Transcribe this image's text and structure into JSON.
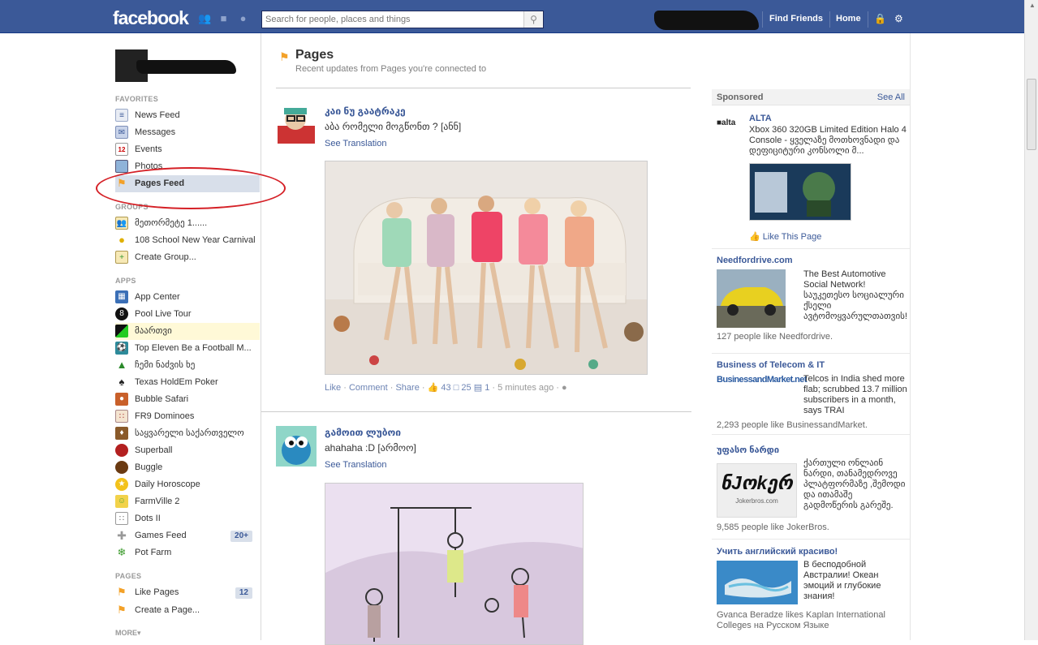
{
  "topbar": {
    "logo": "facebook",
    "search_placeholder": "Search for people, places and things",
    "find_friends": "Find Friends",
    "home": "Home"
  },
  "sidebar": {
    "favorites_header": "FAVORITES",
    "favorites": [
      {
        "label": "News Feed",
        "icon": "news-feed-icon"
      },
      {
        "label": "Messages",
        "icon": "messages-icon"
      },
      {
        "label": "Events",
        "icon": "events-icon",
        "icon_text": "12"
      },
      {
        "label": "Photos",
        "icon": "photos-icon"
      },
      {
        "label": "Pages Feed",
        "icon": "pages-feed-icon"
      }
    ],
    "groups_header": "GROUPS",
    "groups": [
      {
        "label": "მეთორმეტე 1......",
        "icon": "group-icon"
      },
      {
        "label": "108 School New Year Carnival",
        "icon": "lightbulb-icon"
      },
      {
        "label": "Create Group...",
        "icon": "create-group-icon"
      }
    ],
    "apps_header": "APPS",
    "apps": [
      {
        "label": "App Center",
        "icon": "app-center-icon"
      },
      {
        "label": "Pool Live Tour",
        "icon": "pool-icon"
      },
      {
        "label": "მაართვი",
        "icon": "app-icon"
      },
      {
        "label": "Top Eleven Be a Football M...",
        "icon": "football-icon"
      },
      {
        "label": "ჩემი ნაძვის ხე",
        "icon": "tree-icon"
      },
      {
        "label": "Texas HoldEm Poker",
        "icon": "poker-icon"
      },
      {
        "label": "Bubble Safari",
        "icon": "bubble-icon"
      },
      {
        "label": "FR9 Dominoes",
        "icon": "dominoes-icon"
      },
      {
        "label": "საყვარელი საქართველო",
        "icon": "georgia-icon"
      },
      {
        "label": "Superball",
        "icon": "superball-icon"
      },
      {
        "label": "Buggle",
        "icon": "buggle-icon"
      },
      {
        "label": "Daily Horoscope",
        "icon": "horoscope-icon"
      },
      {
        "label": "FarmVille 2",
        "icon": "farmville-icon"
      },
      {
        "label": "Dots II",
        "icon": "dots-icon"
      },
      {
        "label": "Games Feed",
        "icon": "games-feed-icon",
        "badge": "20+"
      },
      {
        "label": "Pot Farm",
        "icon": "pot-farm-icon"
      }
    ],
    "pages_header": "PAGES",
    "pages": [
      {
        "label": "Like Pages",
        "icon": "like-pages-icon",
        "badge": "12"
      },
      {
        "label": "Create a Page...",
        "icon": "create-page-icon"
      }
    ],
    "more": "MORE▾"
  },
  "main": {
    "title": "Pages",
    "subtitle": "Recent updates from Pages you're connected to",
    "stories": [
      {
        "name": "კაი ნუ გაატრაკე",
        "text": "აბა რომელი მოგწონთ ? [ანნ]",
        "see_translation": "See Translation",
        "actions": {
          "like": "Like",
          "comment": "Comment",
          "share": "Share",
          "likes": "43",
          "comments": "25",
          "shares": "1",
          "time": "5 minutes ago"
        }
      },
      {
        "name": "გამოით ლუბოი",
        "text": "ahahaha :D [არმოო]",
        "see_translation": "See Translation"
      }
    ]
  },
  "sponsored": {
    "header": "Sponsored",
    "see_all": "See All",
    "ads": [
      {
        "title": "ALTA",
        "body": "Xbox 360 320GB Limited Edition Halo 4 Console - ყველაზე მოთხოვნადი და დეფიციტური კონსოლი მ...",
        "like_page": "Like This Page"
      },
      {
        "title": "Needfordrive.com",
        "body": "The Best Automotive Social Network! საუკეთესო სოციალური ქსელი ავტომოყვარულთათვის!",
        "likes": "127 people like Needfordrive."
      },
      {
        "title": "Business of Telecom & IT",
        "logo_text": "BusinessandMarket.net",
        "body": "Telcos in India shed more flab; scrubbed 13.7 million subscribers in a month, says TRAI",
        "likes": "2,293 people like BusinessandMarket."
      },
      {
        "title": "უფასო ნარდი",
        "logo_text": "ნJოkერ",
        "logo_sub": "Jokerbros.com",
        "body": "ქართული ონლაინ ნარდი, თანამედროვე პლატფორმაზე ,შემოდი და ითამაშე გადმოწერის გარეშე.",
        "likes": "9,585 people like JokerBros."
      },
      {
        "title": "Учить английский красиво!",
        "body": "В бесподобной Австралии! Океан эмоций и глубокие знания!",
        "likes": "Gvanca Beradze likes Kaplan International Colleges на Русском Языке"
      }
    ]
  }
}
